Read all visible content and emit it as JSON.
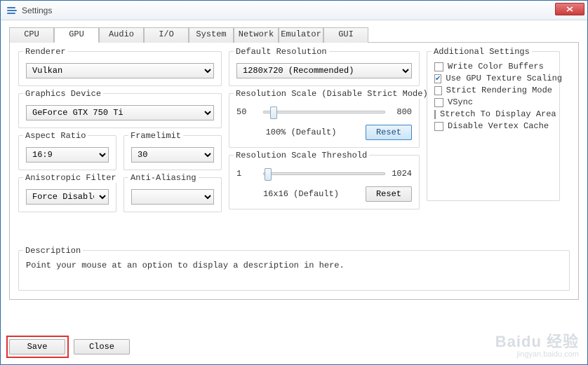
{
  "window": {
    "title": "Settings"
  },
  "tabs": {
    "t0": "CPU",
    "t1": "GPU",
    "t2": "Audio",
    "t3": "I/O",
    "t4": "System",
    "t5": "Network",
    "t6": "Emulator",
    "t7": "GUI"
  },
  "renderer": {
    "legend": "Renderer",
    "value": "Vulkan"
  },
  "graphics_device": {
    "legend": "Graphics Device",
    "value": "GeForce GTX 750 Ti"
  },
  "aspect_ratio": {
    "legend": "Aspect Ratio",
    "value": "16:9"
  },
  "framelimit": {
    "legend": "Framelimit",
    "value": "30"
  },
  "aniso": {
    "legend": "Anisotropic Filter",
    "value": "Force Disabled"
  },
  "aa": {
    "legend": "Anti-Aliasing",
    "value": ""
  },
  "def_res": {
    "legend": "Default Resolution",
    "value": "1280x720 (Recommended)"
  },
  "res_scale": {
    "legend": "Resolution Scale (Disable Strict Mode)",
    "min": "50",
    "max": "800",
    "label": "100% (Default)",
    "reset": "Reset"
  },
  "res_thresh": {
    "legend": "Resolution Scale Threshold",
    "min": "1",
    "max": "1024",
    "label": "16x16 (Default)",
    "reset": "Reset"
  },
  "addl": {
    "legend": "Additional Settings",
    "items": {
      "write_color": {
        "label": "Write Color Buffers",
        "checked": false
      },
      "gpu_tex": {
        "label": "Use GPU Texture Scaling",
        "checked": true
      },
      "strict": {
        "label": "Strict Rendering Mode",
        "checked": false
      },
      "vsync": {
        "label": "VSync",
        "checked": false
      },
      "stretch": {
        "label": "Stretch To Display Area",
        "checked": false
      },
      "dvc": {
        "label": "Disable Vertex Cache",
        "checked": false
      }
    }
  },
  "description": {
    "legend": "Description",
    "text": "Point your mouse at an option to display a description in here."
  },
  "buttons": {
    "save": "Save",
    "close": "Close"
  },
  "watermark": {
    "brand": "Baidu 经验",
    "url": "jingyan.baidu.com"
  }
}
